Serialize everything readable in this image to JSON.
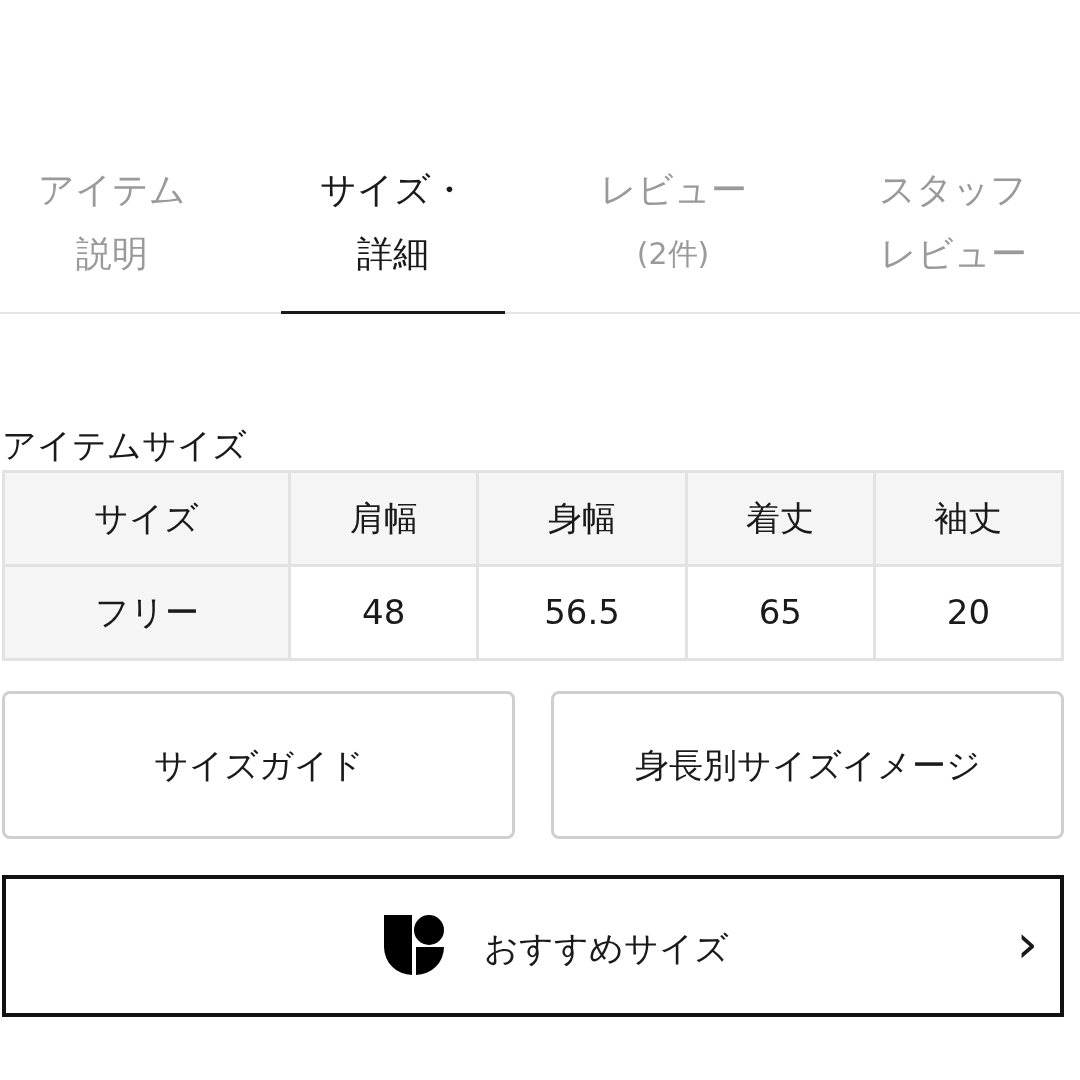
{
  "tabs": [
    {
      "lines": [
        "アイテム",
        "説明"
      ],
      "selected": false
    },
    {
      "lines": [
        "サイズ・",
        "詳細"
      ],
      "selected": true
    },
    {
      "lines": [
        "レビュー",
        "(2件)"
      ],
      "selected": false
    },
    {
      "lines": [
        "スタッフ",
        "レビュー"
      ],
      "selected": false
    }
  ],
  "section_title": "アイテムサイズ",
  "table": {
    "columns": [
      "サイズ",
      "肩幅",
      "身幅",
      "着丈",
      "袖丈"
    ],
    "rows": [
      [
        "フリー",
        "48",
        "56.5",
        "65",
        "20"
      ]
    ]
  },
  "buttons": [
    "サイズガイド",
    "身長別サイズイメージ"
  ],
  "recommend": {
    "label": "おすすめサイズ",
    "arrow": "›"
  }
}
